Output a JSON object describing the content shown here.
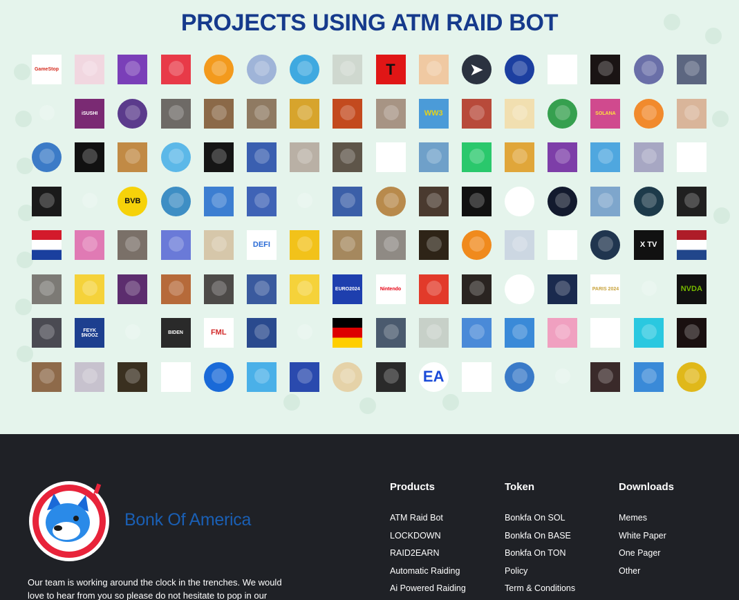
{
  "projects": {
    "title": "PROJECTS USING ATM RAID BOT",
    "logos": [
      {
        "icon": "gamestop-logo",
        "text": "GameStop",
        "bg": "#ffffff",
        "fg": "#d52b1e",
        "round": false
      },
      {
        "icon": "eye-logo",
        "text": "",
        "bg": "#f1d7e0",
        "fg": "#5a2d8c",
        "round": false
      },
      {
        "icon": "anime-girl-logo",
        "text": "",
        "bg": "#7a3fb8",
        "fg": "#ffffff",
        "round": false
      },
      {
        "icon": "cartoon-mascot-logo",
        "text": "",
        "bg": "#e83a48",
        "fg": "#ffffff",
        "round": false
      },
      {
        "icon": "garfield-logo",
        "text": "",
        "bg": "#f39a1d",
        "fg": "#ffffff",
        "round": true
      },
      {
        "icon": "hand-meme-logo",
        "text": "",
        "bg": "#9fb4d8",
        "fg": "#ffffff",
        "round": true
      },
      {
        "icon": "cat-blue-logo",
        "text": "",
        "bg": "#3fa9e0",
        "fg": "#ffffff",
        "round": true
      },
      {
        "icon": "penguin-logo",
        "text": "",
        "bg": "#cfd8cf",
        "fg": "#333333",
        "round": false
      },
      {
        "icon": "letter-t-logo",
        "text": "T",
        "bg": "#e01616",
        "fg": "#111111",
        "round": false
      },
      {
        "icon": "orange-cat-logo",
        "text": "",
        "bg": "#f0c9a2",
        "fg": "#ffffff",
        "round": false
      },
      {
        "icon": "telegram-logo",
        "text": "➤",
        "bg": "#2b3240",
        "fg": "#ffffff",
        "round": true
      },
      {
        "icon": "stars-globe-logo",
        "text": "",
        "bg": "#1c3fa0",
        "fg": "#f2c10d",
        "round": true
      },
      {
        "icon": "red-dog-logo",
        "text": "",
        "bg": "#ffffff",
        "fg": "#d0242b",
        "round": false
      },
      {
        "icon": "fire-planet-logo",
        "text": "",
        "bg": "#1a1414",
        "fg": "#ff8a00",
        "round": false
      },
      {
        "icon": "black-cat-logo",
        "text": "",
        "bg": "#6a6fa8",
        "fg": "#ffffff",
        "round": true
      },
      {
        "icon": "dog-sign-logo",
        "text": "",
        "bg": "#5c6680",
        "fg": "#ffffff",
        "round": false
      },
      {
        "icon": "white-mouse-logo",
        "text": "",
        "bg": "#e5f4ec",
        "fg": "#333333",
        "round": false
      },
      {
        "icon": "isushi-logo",
        "text": "iSUSHI",
        "bg": "#7a2a73",
        "fg": "#ffffff",
        "round": false
      },
      {
        "icon": "purple-dragon-logo",
        "text": "",
        "bg": "#5b3b8c",
        "fg": "#ffffff",
        "round": true
      },
      {
        "icon": "scooter-dog-logo",
        "text": "",
        "bg": "#6e6a66",
        "fg": "#ffffff",
        "round": false
      },
      {
        "icon": "sculpture-logo",
        "text": "",
        "bg": "#8b6948",
        "fg": "#ffffff",
        "round": false
      },
      {
        "icon": "sunglasses-man-logo",
        "text": "",
        "bg": "#8f7a62",
        "fg": "#ffffff",
        "round": false
      },
      {
        "icon": "red-block-logo",
        "text": "",
        "bg": "#d7a42c",
        "fg": "#ffffff",
        "round": false
      },
      {
        "icon": "fire-character-logo",
        "text": "",
        "bg": "#c34a1e",
        "fg": "#ffffff",
        "round": false
      },
      {
        "icon": "cat-stretch-logo",
        "text": "",
        "bg": "#a79484",
        "fg": "#ffffff",
        "round": false
      },
      {
        "icon": "ww3-logo",
        "text": "WW3",
        "bg": "#4b9bd8",
        "fg": "#e5d21a",
        "round": false
      },
      {
        "icon": "trump-logo",
        "text": "",
        "bg": "#b84a3a",
        "fg": "#ffffff",
        "round": false
      },
      {
        "icon": "shiba-bucket-logo",
        "text": "",
        "bg": "#f1dfb0",
        "fg": "#ffffff",
        "round": false
      },
      {
        "icon": "pepe-round-logo",
        "text": "",
        "bg": "#36a04f",
        "fg": "#ffffff",
        "round": true
      },
      {
        "icon": "solana-community-logo",
        "text": "SOLANA",
        "bg": "#d04a8e",
        "fg": "#ffe23d",
        "round": false
      },
      {
        "icon": "shiba-logo",
        "text": "",
        "bg": "#f18a2d",
        "fg": "#ffffff",
        "round": true
      },
      {
        "icon": "baby-logo",
        "text": "",
        "bg": "#d9b59a",
        "fg": "#ffffff",
        "round": false
      },
      {
        "icon": "pepe-pink-logo",
        "text": "",
        "bg": "#3c7bc7",
        "fg": "#ffffff",
        "round": true
      },
      {
        "icon": "orange-bottle-logo",
        "text": "",
        "bg": "#111111",
        "fg": "#f08a1d",
        "round": false
      },
      {
        "icon": "cowboy-dog-logo",
        "text": "",
        "bg": "#c18a45",
        "fg": "#ffffff",
        "round": false
      },
      {
        "icon": "orca-logo",
        "text": "",
        "bg": "#5cb8e8",
        "fg": "#ffffff",
        "round": true
      },
      {
        "icon": "ramen-logo",
        "text": "",
        "bg": "#151515",
        "fg": "#e0752e",
        "round": false
      },
      {
        "icon": "pepe-flag-logo",
        "text": "",
        "bg": "#3a5fb0",
        "fg": "#ffffff",
        "round": false
      },
      {
        "icon": "hamster-logo",
        "text": "",
        "bg": "#b9b0a5",
        "fg": "#ffffff",
        "round": false
      },
      {
        "icon": "wolf-beast-logo",
        "text": "",
        "bg": "#5e5549",
        "fg": "#ffffff",
        "round": false
      },
      {
        "icon": "white-seal-logo",
        "text": "",
        "bg": "#ffffff",
        "fg": "#777777",
        "round": false
      },
      {
        "icon": "throne-logo",
        "text": "",
        "bg": "#6fa0c9",
        "fg": "#ffffff",
        "round": false
      },
      {
        "icon": "green-clover-logo",
        "text": "",
        "bg": "#2ac86c",
        "fg": "#2b9ad6",
        "round": false
      },
      {
        "icon": "monkey-logo",
        "text": "",
        "bg": "#e0a63a",
        "fg": "#ffffff",
        "round": false
      },
      {
        "icon": "green-watch-logo",
        "text": "",
        "bg": "#7d3ea8",
        "fg": "#19c13a",
        "round": false
      },
      {
        "icon": "bitcoin-man-logo",
        "text": "",
        "bg": "#4fa7df",
        "fg": "#ffffff",
        "round": false
      },
      {
        "icon": "rick-astley-logo",
        "text": "",
        "bg": "#a7a7c3",
        "fg": "#ffffff",
        "round": false
      },
      {
        "icon": "cartoon-dog-logo",
        "text": "",
        "bg": "#ffffff",
        "fg": "#e8c23a",
        "round": false
      },
      {
        "icon": "winged-skull-logo",
        "text": "",
        "bg": "#1a1a1a",
        "fg": "#d22a2a",
        "round": false
      },
      {
        "icon": "purple-ghost-logo",
        "text": "",
        "bg": "#e5f4ec",
        "fg": "#6a2c9a",
        "round": false
      },
      {
        "icon": "bvb-logo",
        "text": "BVB",
        "bg": "#f6d20a",
        "fg": "#111111",
        "round": true
      },
      {
        "icon": "blue-cat-logo",
        "text": "",
        "bg": "#3e8ec4",
        "fg": "#ffffff",
        "round": true
      },
      {
        "icon": "pixel-frog-logo",
        "text": "",
        "bg": "#3c7ed1",
        "fg": "#f2d12a",
        "round": false
      },
      {
        "icon": "dog-face-logo",
        "text": "",
        "bg": "#3f63b6",
        "fg": "#ffffff",
        "round": false
      },
      {
        "icon": "kitten-logo",
        "text": "",
        "bg": "#e5f4ec",
        "fg": "#c47a3a",
        "round": false
      },
      {
        "icon": "blue-throne-logo",
        "text": "",
        "bg": "#3b5fa8",
        "fg": "#ffffff",
        "round": false
      },
      {
        "icon": "ancient-coin-logo",
        "text": "",
        "bg": "#b88a4c",
        "fg": "#ffffff",
        "round": true
      },
      {
        "icon": "heel-shoe-logo",
        "text": "",
        "bg": "#4a3a2f",
        "fg": "#e0a0c0",
        "round": false
      },
      {
        "icon": "red-mushroom-logo",
        "text": "",
        "bg": "#111111",
        "fg": "#e22a2a",
        "round": false
      },
      {
        "icon": "gold-dog-logo",
        "text": "",
        "bg": "#ffffff",
        "fg": "#c9a23a",
        "round": true
      },
      {
        "icon": "cube-logo",
        "text": "",
        "bg": "#131a2e",
        "fg": "#40d3e0",
        "round": true
      },
      {
        "icon": "snow-forest-logo",
        "text": "",
        "bg": "#7ea6cc",
        "fg": "#ffffff",
        "round": false
      },
      {
        "icon": "purple-dragon-2-logo",
        "text": "",
        "bg": "#1d3a4a",
        "fg": "#9b4ac8",
        "round": true
      },
      {
        "icon": "hooded-figure-logo",
        "text": "",
        "bg": "#202020",
        "fg": "#ffffff",
        "round": false
      },
      {
        "icon": "croatia-flag-logo",
        "text": "",
        "bg": "#ffffff",
        "fg": "#d31a2b",
        "round": false
      },
      {
        "icon": "blue-monster-logo",
        "text": "",
        "bg": "#e07ab4",
        "fg": "#4fc0e8",
        "round": false
      },
      {
        "icon": "cat-sign-logo",
        "text": "",
        "bg": "#7a7068",
        "fg": "#ffffff",
        "round": false
      },
      {
        "icon": "daffy-duck-logo",
        "text": "",
        "bg": "#6a7ad8",
        "fg": "#111111",
        "round": false
      },
      {
        "icon": "doge-cap-logo",
        "text": "",
        "bg": "#d6c7aa",
        "fg": "#111111",
        "round": false
      },
      {
        "icon": "defi-logo",
        "text": "DEFI",
        "bg": "#ffffff",
        "fg": "#2a6bd6",
        "round": false
      },
      {
        "icon": "green-alien-logo",
        "text": "",
        "bg": "#f2c21a",
        "fg": "#3a8a3a",
        "round": false
      },
      {
        "icon": "mouse-toy-logo",
        "text": "",
        "bg": "#a5885e",
        "fg": "#ffffff",
        "round": false
      },
      {
        "icon": "bike-dog-logo",
        "text": "",
        "bg": "#8f8a84",
        "fg": "#ffffff",
        "round": false
      },
      {
        "icon": "sign-logo",
        "text": "",
        "bg": "#2e2417",
        "fg": "#e0b23a",
        "round": false
      },
      {
        "icon": "goblin-logo",
        "text": "",
        "bg": "#f08a1d",
        "fg": "#3a9a3a",
        "round": true
      },
      {
        "icon": "pepe-suit-logo",
        "text": "",
        "bg": "#ccd7e2",
        "fg": "#3a8a3a",
        "round": false
      },
      {
        "icon": "shaka-logo",
        "text": "",
        "bg": "#ffffff",
        "fg": "#111111",
        "round": false
      },
      {
        "icon": "fancy-cat-logo",
        "text": "",
        "bg": "#20354f",
        "fg": "#ffffff",
        "round": true
      },
      {
        "icon": "x-tv-logo",
        "text": "X TV",
        "bg": "#111111",
        "fg": "#ffffff",
        "round": false
      },
      {
        "icon": "netherlands-flag-logo",
        "text": "",
        "bg": "#ffffff",
        "fg": "#ae1c28",
        "round": false
      },
      {
        "icon": "trump-crowd-logo",
        "text": "",
        "bg": "#7c7a75",
        "fg": "#ffffff",
        "round": false
      },
      {
        "icon": "yellow-leaf-logo",
        "text": "",
        "bg": "#f5d23a",
        "fg": "#3a8a3a",
        "round": false
      },
      {
        "icon": "pepe-dance-logo",
        "text": "",
        "bg": "#5c2d6e",
        "fg": "#e23a3a",
        "round": false
      },
      {
        "icon": "dogs-table-logo",
        "text": "",
        "bg": "#b66a3a",
        "fg": "#ffffff",
        "round": false
      },
      {
        "icon": "sleeping-cat-logo",
        "text": "",
        "bg": "#4d4a48",
        "fg": "#ffffff",
        "round": false
      },
      {
        "icon": "elon-logo",
        "text": "",
        "bg": "#3a5a9e",
        "fg": "#ffffff",
        "round": false
      },
      {
        "icon": "gold-man-logo",
        "text": "",
        "bg": "#f5d23a",
        "fg": "#111111",
        "round": false
      },
      {
        "icon": "euro2024-logo",
        "text": "EURO2024",
        "bg": "#1e3fae",
        "fg": "#ffffff",
        "round": false
      },
      {
        "icon": "nintendo-logo",
        "text": "Nintendo",
        "bg": "#ffffff",
        "fg": "#e60012",
        "round": false
      },
      {
        "icon": "mario-dog-logo",
        "text": "",
        "bg": "#e23a2a",
        "fg": "#ffffff",
        "round": false
      },
      {
        "icon": "black-cat-2-logo",
        "text": "",
        "bg": "#2a2421",
        "fg": "#ffffff",
        "round": false
      },
      {
        "icon": "no-cat-logo",
        "text": "",
        "bg": "#ffffff",
        "fg": "#e22a2a",
        "round": true
      },
      {
        "icon": "astronaut-logo",
        "text": "",
        "bg": "#1a2a4e",
        "fg": "#ffffff",
        "round": false
      },
      {
        "icon": "paris2024-logo",
        "text": "PARIS 2024",
        "bg": "#ffffff",
        "fg": "#c8a23a",
        "round": false
      },
      {
        "icon": "purple-blob-logo",
        "text": "",
        "bg": "#e5f4ec",
        "fg": "#7a2ac8",
        "round": false
      },
      {
        "icon": "nvidia-logo",
        "text": "NVDA",
        "bg": "#111111",
        "fg": "#76b900",
        "round": false
      },
      {
        "icon": "batman-logo",
        "text": "",
        "bg": "#4a4a52",
        "fg": "#ffffff",
        "round": false
      },
      {
        "icon": "feyk-snooz-logo",
        "text": "FEYK $NOOZ",
        "bg": "#1d3f8f",
        "fg": "#ffffff",
        "round": false
      },
      {
        "icon": "angry-fire-logo",
        "text": "",
        "bg": "#e5f4ec",
        "fg": "#e2421a",
        "round": false
      },
      {
        "icon": "biden-logo",
        "text": "BIDEN",
        "bg": "#2a2a2a",
        "fg": "#ffffff",
        "round": false
      },
      {
        "icon": "nfl-logo",
        "text": "FML",
        "bg": "#ffffff",
        "fg": "#d22a2a",
        "round": false
      },
      {
        "icon": "sumo-logo",
        "text": "",
        "bg": "#2a4a8e",
        "fg": "#f0a0a0",
        "round": false
      },
      {
        "icon": "alien-dog-logo",
        "text": "",
        "bg": "#e5f4ec",
        "fg": "#b07a4a",
        "round": false
      },
      {
        "icon": "germany-flag-logo",
        "text": "",
        "bg": "#dd0000",
        "fg": "#000000",
        "round": false
      },
      {
        "icon": "bulldog-sign-logo",
        "text": "",
        "bg": "#4a5a6e",
        "fg": "#ffffff",
        "round": false
      },
      {
        "icon": "penguins-logo",
        "text": "",
        "bg": "#c7d0c8",
        "fg": "#333333",
        "round": false
      },
      {
        "icon": "pixel-man-logo",
        "text": "",
        "bg": "#4a8ad8",
        "fg": "#ffffff",
        "round": false
      },
      {
        "icon": "white-cat-logo",
        "text": "",
        "bg": "#3a8ad8",
        "fg": "#ffffff",
        "round": false
      },
      {
        "icon": "pink-pepe-logo",
        "text": "",
        "bg": "#f0a0c0",
        "fg": "#ffffff",
        "round": false
      },
      {
        "icon": "camel-logo",
        "text": "",
        "bg": "#ffffff",
        "fg": "#3a9a3a",
        "round": false
      },
      {
        "icon": "orange-ape-logo",
        "text": "",
        "bg": "#2ac8e0",
        "fg": "#c86a1a",
        "round": false
      },
      {
        "icon": "burning-planet-logo",
        "text": "",
        "bg": "#1a1010",
        "fg": "#ff7a00",
        "round": false
      },
      {
        "icon": "gold-statue-logo",
        "text": "",
        "bg": "#8e6a4a",
        "fg": "#ffffff",
        "round": false
      },
      {
        "icon": "abstract-logo",
        "text": "",
        "bg": "#c7c2ce",
        "fg": "#ffffff",
        "round": false
      },
      {
        "icon": "banana-logo",
        "text": "",
        "bg": "#3a3020",
        "fg": "#f0c21a",
        "round": false
      },
      {
        "icon": "shiba-face-logo",
        "text": "",
        "bg": "#ffffff",
        "fg": "#e08a3a",
        "round": false
      },
      {
        "icon": "e-round-logo",
        "text": "",
        "bg": "#1a6ad8",
        "fg": "#ffffff",
        "round": true
      },
      {
        "icon": "hat-logo",
        "text": "",
        "bg": "#4ab0e8",
        "fg": "#c86a3a",
        "round": false
      },
      {
        "icon": "usa-dog-logo",
        "text": "",
        "bg": "#2a4aae",
        "fg": "#ffffff",
        "round": false
      },
      {
        "icon": "doge-round-logo",
        "text": "",
        "bg": "#e5d2a8",
        "fg": "#c8883a",
        "round": true
      },
      {
        "icon": "bart-logo",
        "text": "",
        "bg": "#2a2a2a",
        "fg": "#f0d21a",
        "round": false
      },
      {
        "icon": "ea-sports-logo",
        "text": "EA",
        "bg": "#ffffff",
        "fg": "#1a4ad8",
        "round": true
      },
      {
        "icon": "stick-figure-logo",
        "text": "",
        "bg": "#ffffff",
        "fg": "#4a6ae8",
        "round": false
      },
      {
        "icon": "crab-logo",
        "text": "",
        "bg": "#3a7ac8",
        "fg": "#e2421a",
        "round": true
      },
      {
        "icon": "golden-dog-logo",
        "text": "",
        "bg": "#e5f4ec",
        "fg": "#d08a3a",
        "round": false
      },
      {
        "icon": "jason-logo",
        "text": "",
        "bg": "#3a2a2a",
        "fg": "#ffffff",
        "round": false
      },
      {
        "icon": "beach-dog-logo",
        "text": "",
        "bg": "#3a8ad8",
        "fg": "#c8883a",
        "round": false
      },
      {
        "icon": "gold-triangle-logo",
        "text": "",
        "bg": "#e0b81a",
        "fg": "#6a2ac8",
        "round": true
      }
    ]
  },
  "footer": {
    "brand_name": "Bonk Of America",
    "blurb": "Our team is working around the clock in the trenches. We would love to hear from you so please do not hesitate to pop in our",
    "columns": [
      {
        "title": "Products",
        "links": [
          "ATM Raid Bot",
          "LOCKDOWN",
          "RAID2EARN",
          "Automatic Raiding",
          "Ai Powered Raiding"
        ]
      },
      {
        "title": "Token",
        "links": [
          "Bonkfa On SOL",
          "Bonkfa On BASE",
          "Bonkfa On TON",
          "Policy",
          "Term & Conditions"
        ]
      },
      {
        "title": "Downloads",
        "links": [
          "Memes",
          "White Paper",
          "One Pager",
          "Other"
        ]
      }
    ]
  }
}
